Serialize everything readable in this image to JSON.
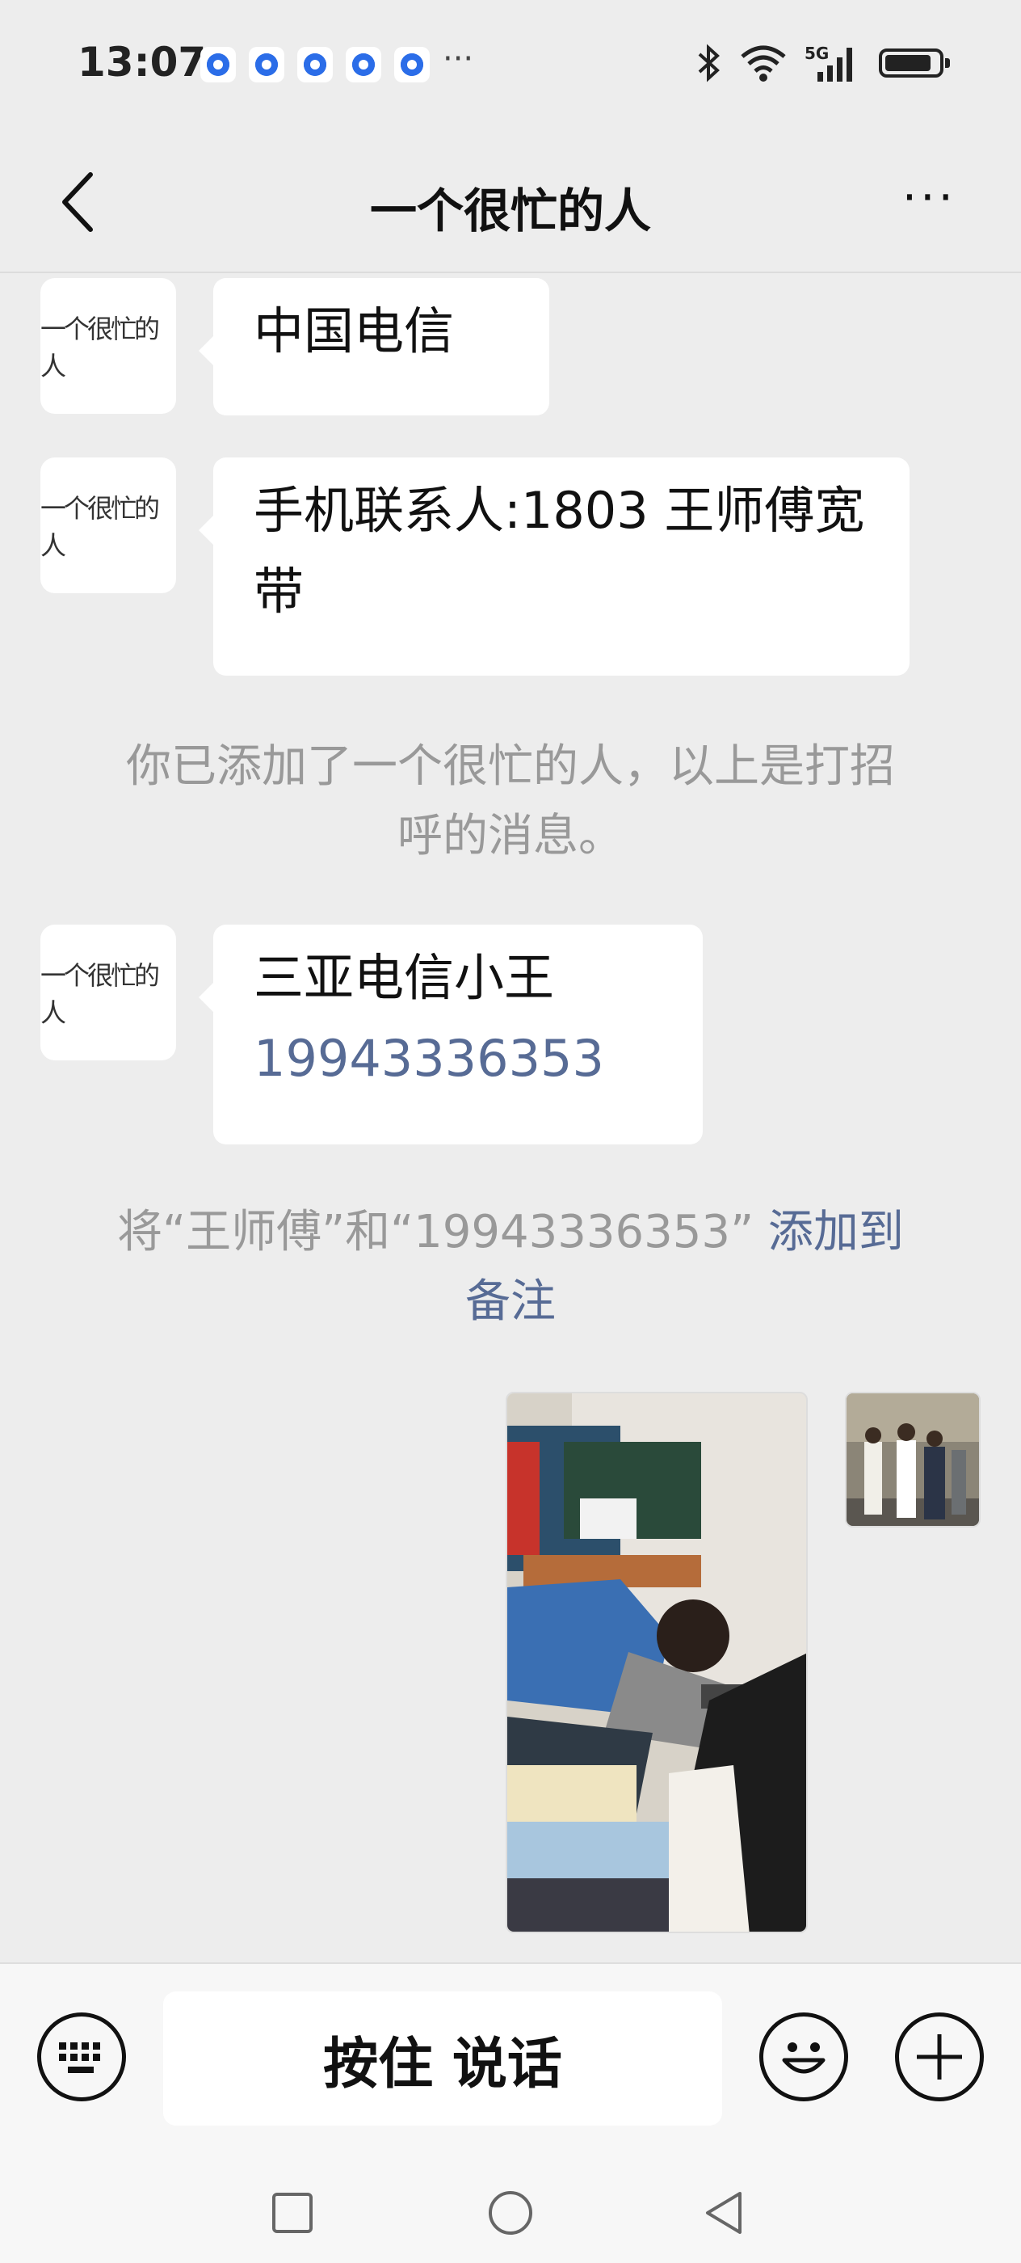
{
  "status_bar": {
    "time": "13:07",
    "more": "···",
    "icons": [
      "bluetooth-icon",
      "wifi-icon",
      "5g-signal-icon",
      "battery-icon"
    ]
  },
  "header": {
    "title": "一个很忙的人",
    "back_icon": "chevron-left-icon",
    "more": "···"
  },
  "avatar_text": "一个很忙的人",
  "messages": [
    {
      "text": "中国电信"
    },
    {
      "text": "手机联系人:1803 王师傅宽带"
    },
    {
      "system": "你已添加了一个很忙的人，以上是打招呼的消息。"
    },
    {
      "line1": "三亚电信小王",
      "link": "19943336353"
    },
    {
      "system_prefix": "将“王师傅”和“19943336353”",
      "system_link": "添加到备注"
    }
  ],
  "input_bar": {
    "hold_to_talk": "按住 说话",
    "keyboard_icon": "keyboard-icon",
    "emoji_icon": "emoji-icon",
    "plus_icon": "plus-circle-icon"
  },
  "nav": [
    "square-icon",
    "circle-icon",
    "back-triangle-icon"
  ],
  "colors": {
    "link": "#576b95",
    "background": "#ededed",
    "notification": "#2b6de8"
  }
}
